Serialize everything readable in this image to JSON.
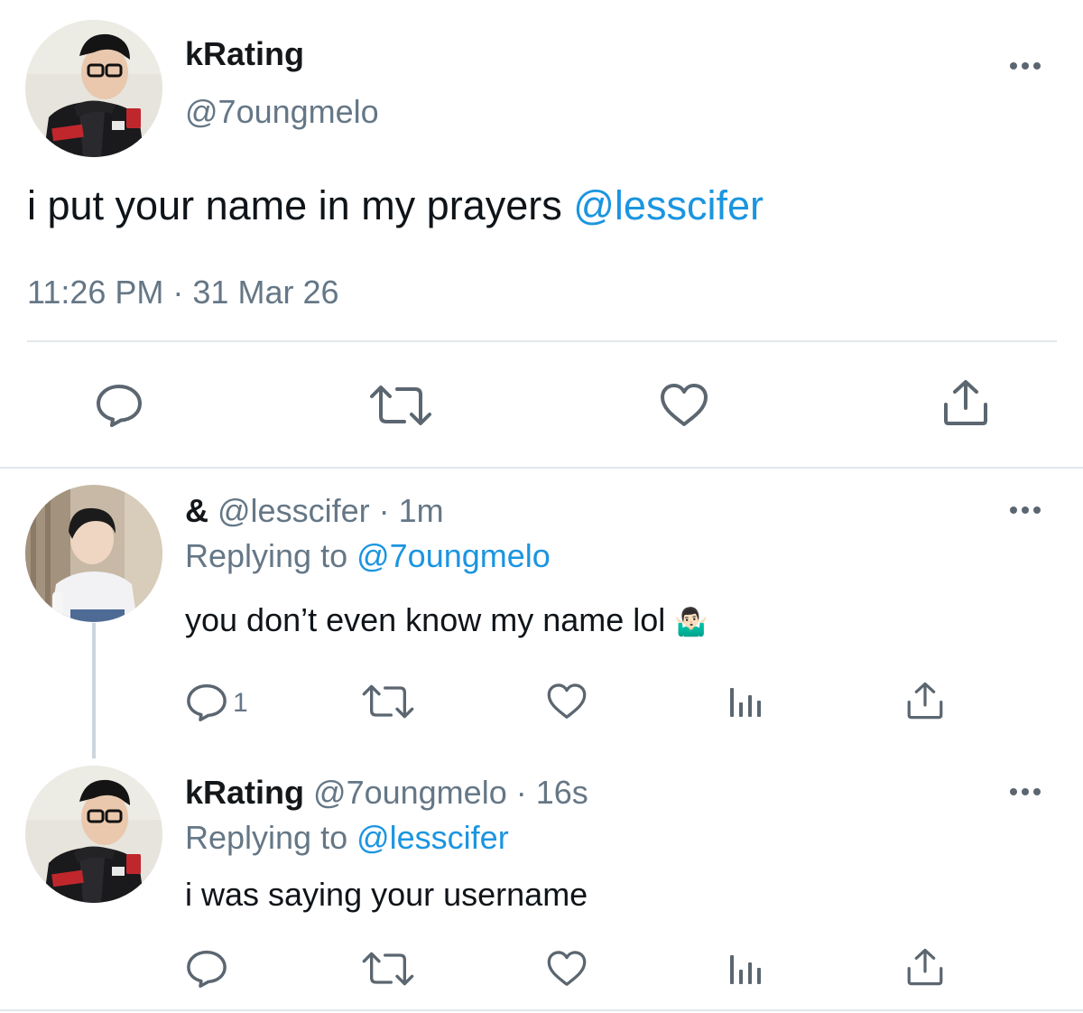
{
  "main_tweet": {
    "display_name": "kRating",
    "handle": "@7oungmelo",
    "text_prefix": "i put your name in my prayers ",
    "mention": "@lesscifer",
    "timestamp": "11:26 PM · 31 Mar 26",
    "actions": [
      "reply-icon",
      "retweet-icon",
      "like-icon",
      "share-icon"
    ]
  },
  "replies": [
    {
      "display_name": "&",
      "handle": "@lesscifer",
      "time": "· 1m",
      "replying_prefix": "Replying to ",
      "replying_to": "@7oungmelo",
      "text": "you don’t even know my name lol",
      "emoji": "🤷🏻‍♂️",
      "reply_count": "1"
    },
    {
      "display_name": "kRating",
      "handle": "@7oungmelo",
      "time": "· 16s",
      "replying_prefix": "Replying to ",
      "replying_to": "@lesscifer",
      "text": "i was saying your username",
      "reply_count": ""
    }
  ],
  "colors": {
    "link": "#1b95e0",
    "muted": "#657786",
    "icon": "#5b6670",
    "divider": "#e1e8ed"
  }
}
